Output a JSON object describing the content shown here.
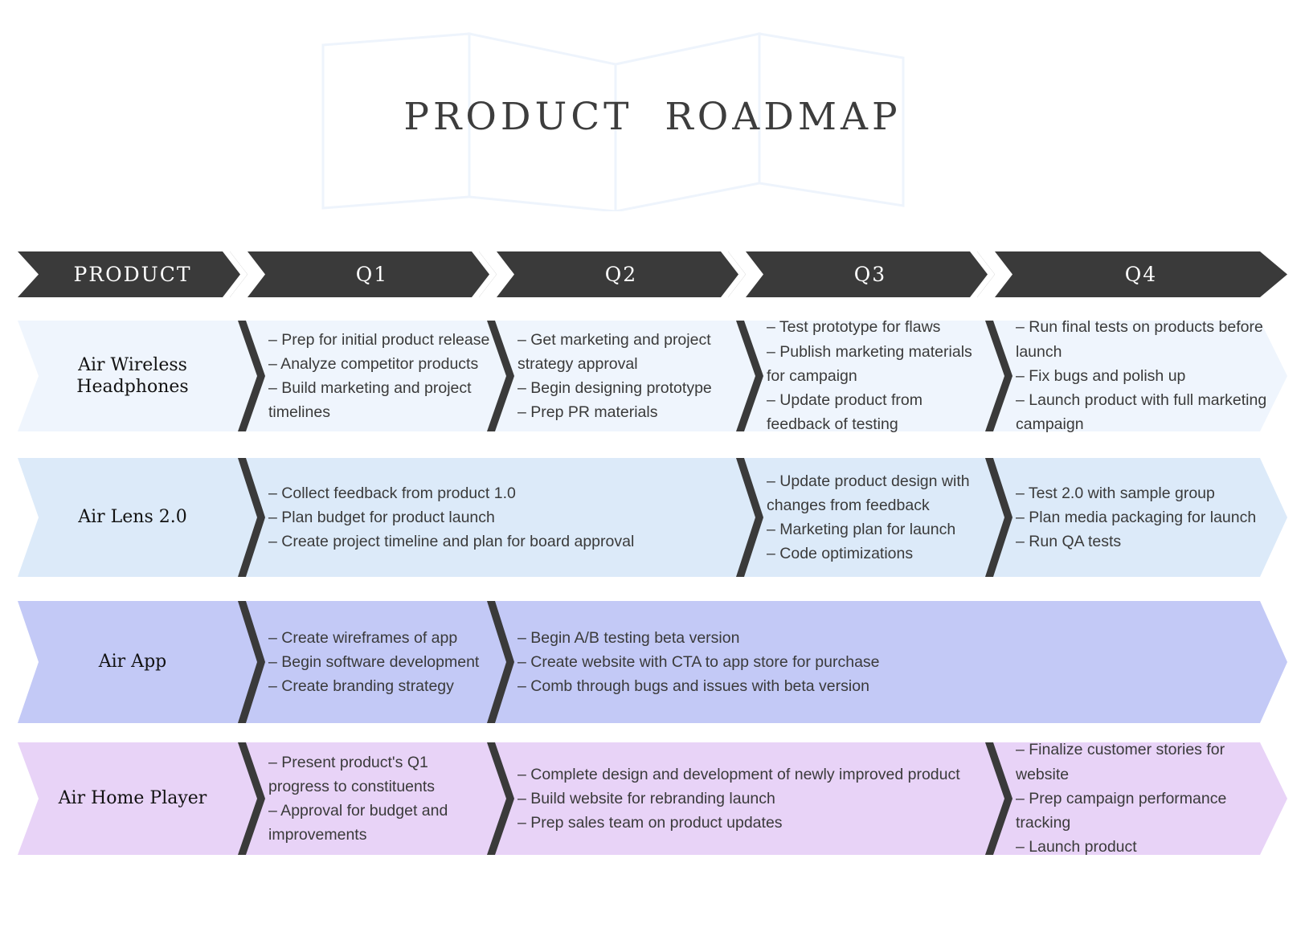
{
  "title": "PRODUCT  ROADMAP",
  "colors": {
    "header_dark": "#3a3a3a",
    "divider_dark": "#3a3a3a",
    "title_text": "#3d3d3d",
    "body_text": "#3a3a3a",
    "watermark": "#eff5fd",
    "row1_band": "#eff5fd",
    "row2_band": "#dceaf9",
    "row3_band": "#c3c9f6",
    "row4_band": "#e8d3f7"
  },
  "header": {
    "columns": [
      {
        "label": "PRODUCT"
      },
      {
        "label": "Q1"
      },
      {
        "label": "Q2"
      },
      {
        "label": "Q3"
      },
      {
        "label": "Q4"
      }
    ]
  },
  "rows": [
    {
      "product": "Air Wireless Headphones",
      "cells": [
        {
          "quarter": "Q1",
          "span": 1,
          "items": [
            "– Prep for initial product release",
            "– Analyze competitor products",
            "– Build marketing and project timelines"
          ]
        },
        {
          "quarter": "Q2",
          "span": 1,
          "items": [
            "– Get marketing and project strategy approval",
            "– Begin designing prototype",
            "– Prep PR materials"
          ]
        },
        {
          "quarter": "Q3",
          "span": 1,
          "items": [
            "– Test prototype for flaws",
            "– Publish marketing materials for campaign",
            "– Update product from feedback of testing"
          ]
        },
        {
          "quarter": "Q4",
          "span": 1,
          "items": [
            "– Run final tests on products before launch",
            "– Fix bugs and polish up",
            "– Launch product with full marketing campaign"
          ]
        }
      ]
    },
    {
      "product": "Air Lens 2.0",
      "cells": [
        {
          "quarter": "Q1",
          "span": 2,
          "items": [
            "– Collect feedback from product 1.0",
            "– Plan budget for product launch",
            "– Create project timeline and plan for board approval"
          ]
        },
        {
          "quarter": "Q3",
          "span": 1,
          "items": [
            "– Update product design with changes from feedback",
            "– Marketing plan for launch",
            "– Code optimizations"
          ]
        },
        {
          "quarter": "Q4",
          "span": 1,
          "items": [
            "– Test 2.0 with sample group",
            "– Plan media packaging for launch",
            "– Run QA tests"
          ]
        }
      ]
    },
    {
      "product": "Air App",
      "cells": [
        {
          "quarter": "Q1",
          "span": 1,
          "items": [
            "– Create wireframes of app",
            "– Begin software development",
            "– Create branding strategy"
          ]
        },
        {
          "quarter": "Q2",
          "span": 3,
          "items": [
            "– Begin A/B testing beta version",
            "– Create website with CTA to app store for purchase",
            "– Comb through bugs and issues with beta version"
          ]
        }
      ]
    },
    {
      "product": "Air Home Player",
      "cells": [
        {
          "quarter": "Q1",
          "span": 1,
          "items": [
            "– Present product's Q1 progress to constituents",
            "– Approval for budget and improvements"
          ]
        },
        {
          "quarter": "Q2",
          "span": 2,
          "items": [
            "– Complete design and development of newly improved product",
            "– Build website for rebranding launch",
            "– Prep sales team on product updates"
          ]
        },
        {
          "quarter": "Q4",
          "span": 1,
          "items": [
            "– Finalize customer stories for website",
            "– Prep campaign performance tracking",
            "– Launch product"
          ]
        }
      ]
    }
  ]
}
